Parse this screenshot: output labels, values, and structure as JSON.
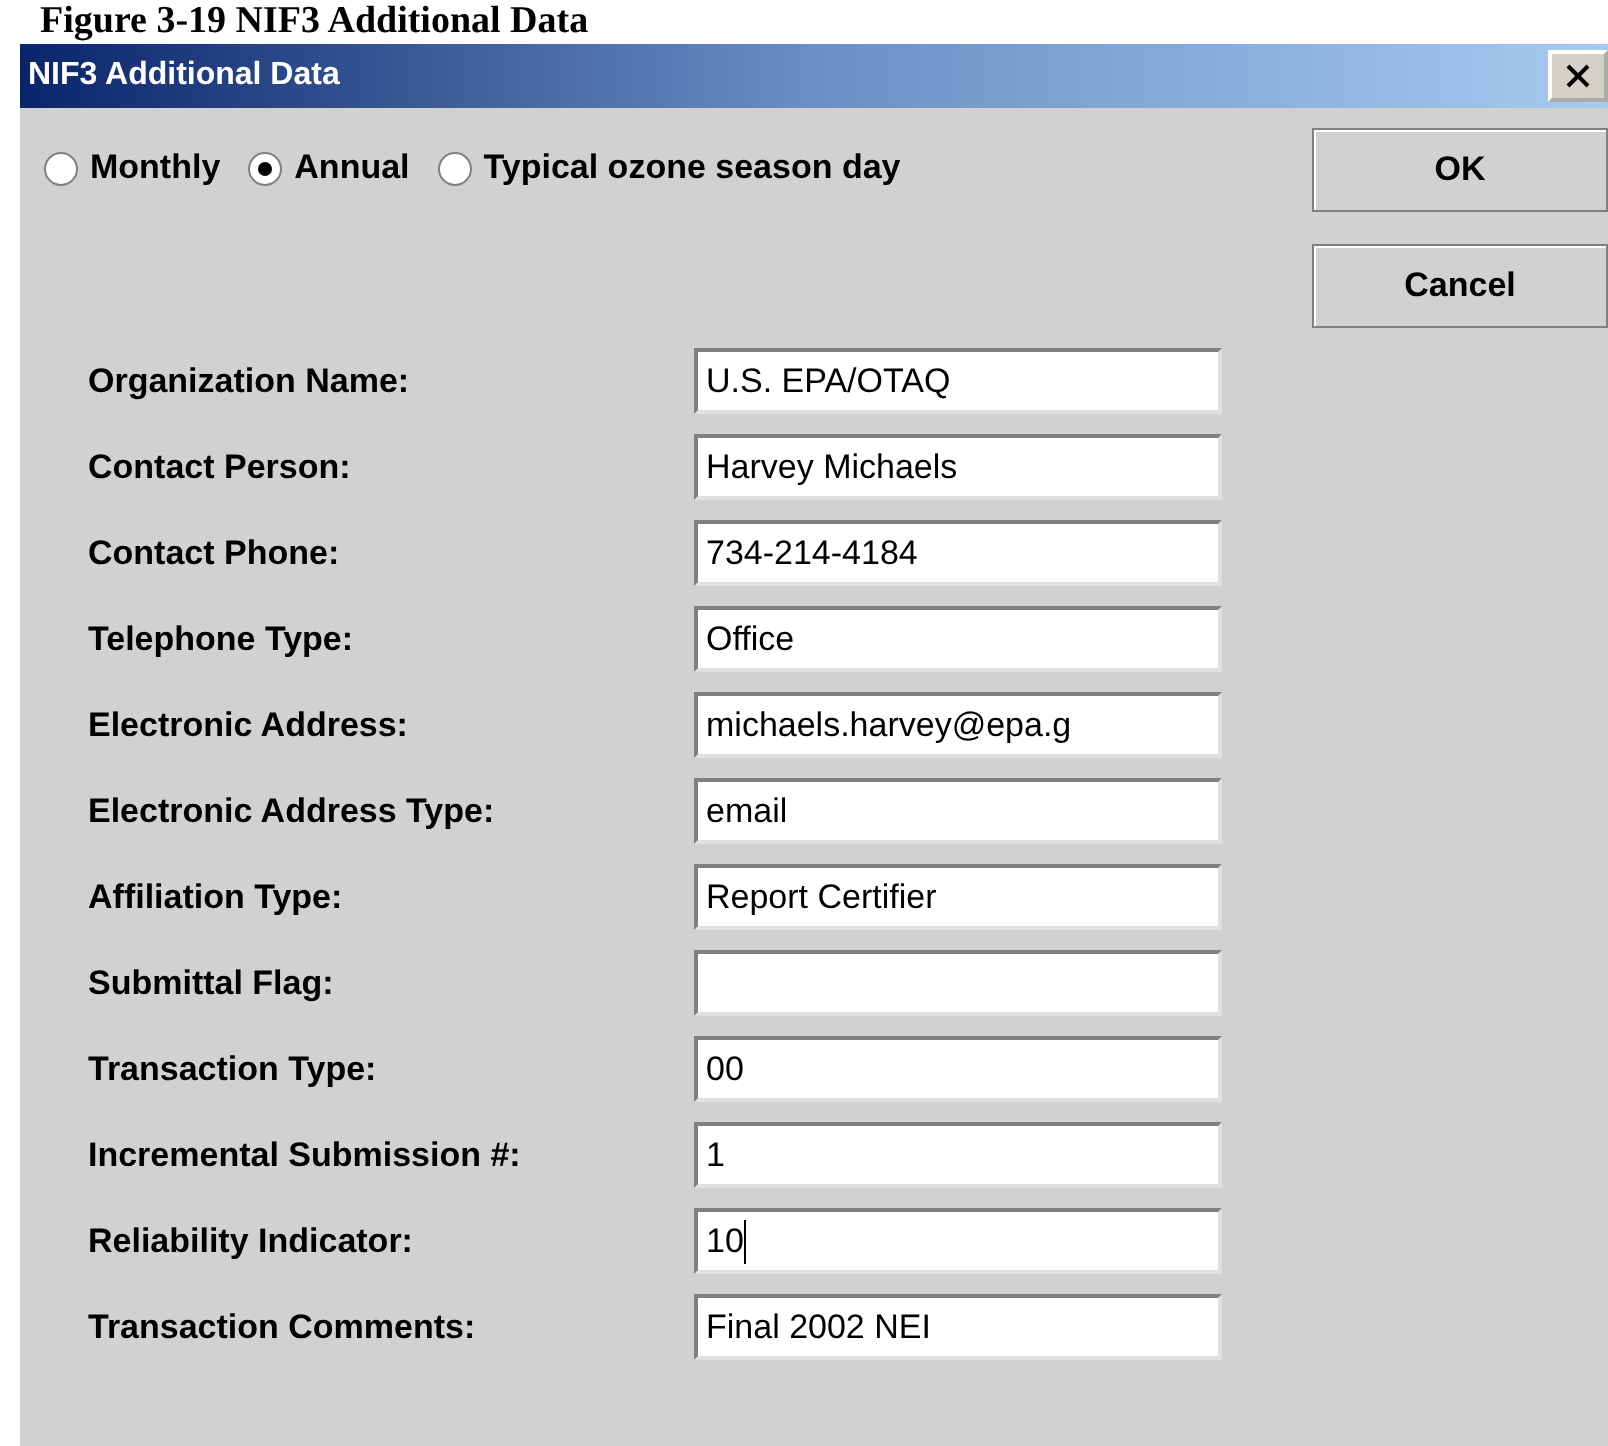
{
  "caption": "Figure 3-19 NIF3 Additional Data",
  "window": {
    "title": "NIF3 Additional Data"
  },
  "period_options": [
    {
      "label": "Monthly",
      "selected": false
    },
    {
      "label": "Annual",
      "selected": true
    },
    {
      "label": "Typical ozone season day",
      "selected": false
    }
  ],
  "buttons": [
    "OK",
    "Cancel"
  ],
  "fields": [
    {
      "label": "Organization Name:",
      "value": "U.S. EPA/OTAQ",
      "focused": false
    },
    {
      "label": "Contact Person:",
      "value": "Harvey Michaels",
      "focused": false
    },
    {
      "label": "Contact Phone:",
      "value": "734-214-4184",
      "focused": false
    },
    {
      "label": "Telephone Type:",
      "value": "Office",
      "focused": false
    },
    {
      "label": "Electronic Address:",
      "value": "michaels.harvey@epa.g",
      "focused": false
    },
    {
      "label": "Electronic Address Type:",
      "value": "email",
      "focused": false
    },
    {
      "label": "Affiliation Type:",
      "value": "Report Certifier",
      "focused": false
    },
    {
      "label": "Submittal Flag:",
      "focused": false
    },
    {
      "label": "Transaction Type:",
      "value": "00",
      "focused": false
    },
    {
      "label": "Incremental Submission #:",
      "value": "1",
      "focused": false
    },
    {
      "label": "Reliability Indicator:",
      "value": "10",
      "focused": true
    },
    {
      "label": "Transaction Comments:",
      "value": "Final 2002 NEI",
      "focused": false
    }
  ]
}
